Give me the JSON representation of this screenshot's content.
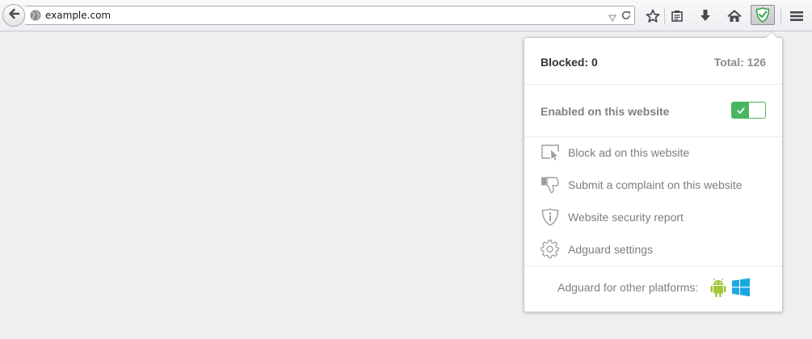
{
  "browser": {
    "url": "example.com",
    "icons": [
      "back-arrow-icon",
      "globe-icon",
      "dropdown-icon",
      "reload-icon",
      "star-icon",
      "reading-list-icon",
      "download-icon",
      "home-icon",
      "adguard-shield-icon",
      "hamburger-menu-icon"
    ]
  },
  "popup": {
    "blocked_label": "Blocked: 0",
    "total_label": "Total: 126",
    "enabled_label": "Enabled on this website",
    "toggle_state": "on",
    "menu": [
      {
        "label": "Block ad on this website",
        "icon": "block-ad-icon"
      },
      {
        "label": "Submit a complaint on this website",
        "icon": "thumbs-down-icon"
      },
      {
        "label": "Website security report",
        "icon": "security-shield-icon"
      },
      {
        "label": "Adguard settings",
        "icon": "gear-icon"
      }
    ],
    "footer_label": "Adguard for other platforms:",
    "platform_icons": [
      "android-icon",
      "windows-icon"
    ]
  },
  "colors": {
    "accent_green": "#4ab55f",
    "android_green": "#a4c639",
    "windows_blue": "#1aa7e0",
    "background": "#efeff2"
  }
}
